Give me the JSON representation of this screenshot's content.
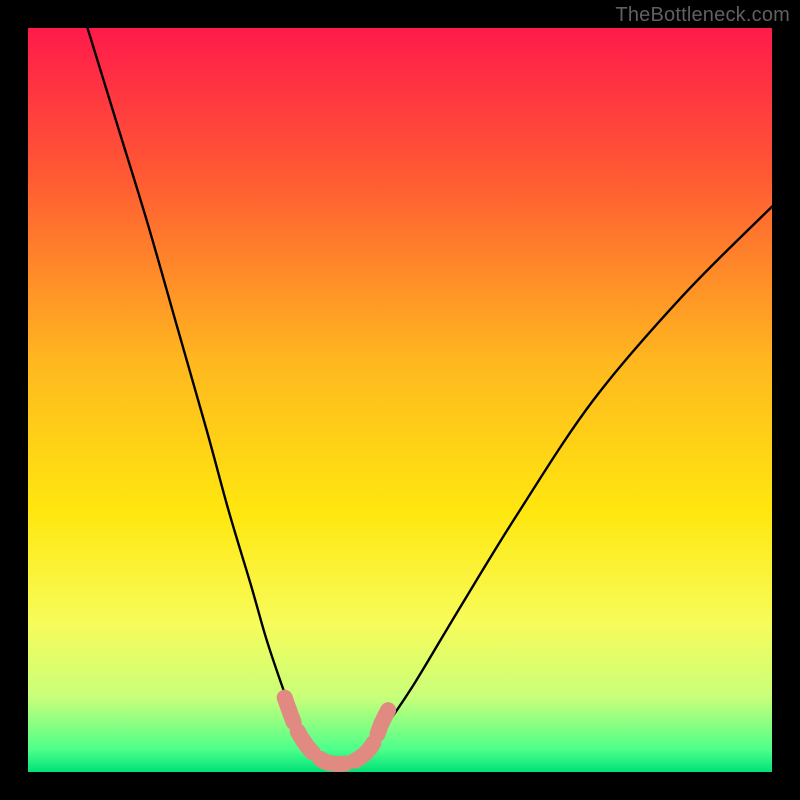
{
  "watermark": "TheBottleneck.com",
  "chart_data": {
    "type": "line",
    "title": "",
    "xlabel": "",
    "ylabel": "",
    "xlim": [
      0,
      100
    ],
    "ylim": [
      0,
      100
    ],
    "grid": false,
    "legend": false,
    "background": "rainbow-gradient",
    "gradient_stops": [
      {
        "pos": 0.0,
        "color": "#ff1a4b"
      },
      {
        "pos": 0.2,
        "color": "#ff5a33"
      },
      {
        "pos": 0.45,
        "color": "#ffb81f"
      },
      {
        "pos": 0.65,
        "color": "#ffe70f"
      },
      {
        "pos": 0.8,
        "color": "#f7fc5a"
      },
      {
        "pos": 0.9,
        "color": "#c8ff7a"
      },
      {
        "pos": 0.97,
        "color": "#4dff8a"
      },
      {
        "pos": 1.0,
        "color": "#00e27a"
      }
    ],
    "series": [
      {
        "name": "bottleneck-curve",
        "type": "line",
        "color": "#000000",
        "x": [
          8,
          12,
          16,
          20,
          24,
          27,
          30,
          32,
          34,
          35.5,
          37,
          38.5,
          40,
          43,
          46,
          48,
          52,
          58,
          66,
          76,
          88,
          100
        ],
        "y": [
          100,
          87,
          74,
          60,
          46,
          35,
          25,
          18,
          12,
          8,
          5,
          3,
          1.5,
          1.5,
          3,
          6,
          12,
          22,
          35,
          50,
          64,
          76
        ]
      },
      {
        "name": "highlight-zone",
        "type": "line",
        "color": "#e18a82",
        "stroke_width": 16,
        "linecap": "round",
        "x": [
          34.5,
          36,
          37.5,
          39,
          40.5,
          43,
          45,
          46.5,
          47.5,
          48.5
        ],
        "y": [
          10,
          6,
          3.5,
          2,
          1.2,
          1.2,
          2.2,
          4,
          6.5,
          8.5
        ]
      }
    ]
  }
}
